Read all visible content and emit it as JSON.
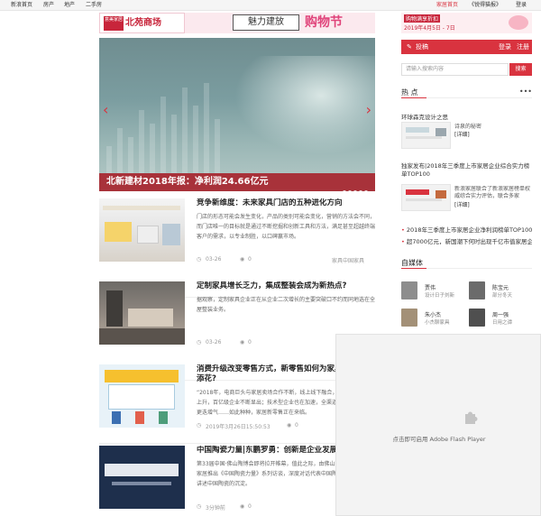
{
  "topbar": {
    "nav": [
      "新浪首页",
      "房产",
      "地产",
      "二手房"
    ],
    "right": {
      "home": "家居首页",
      "group": "《锐得猫报》",
      "login": "登录"
    }
  },
  "ad_banner": {
    "brand_small": "意美家居",
    "shop": "北苑商场",
    "slogan": "魅力建放",
    "event": "购物节",
    "side_tag": "购物满享折扣",
    "side_date": "2019年4月5日 - 7日"
  },
  "slider": {
    "caption": "北新建材2018年报：净利润24.66亿元",
    "dots": 5
  },
  "articles": [
    {
      "title": "竞争新维度：未来家具门店的五种进化方向",
      "desc": "门店的形态可能会发生变化，产品的类别可能会变化，营销的方法会不同，而门店唯一的目标就是通过不断挖掘和创新工具和方法，满足甚至超越终端客户的需求，以专业制胜，以口碑赢市场。",
      "date": "03-26",
      "views": "0",
      "source": "家具中国家具"
    },
    {
      "title": "定制家具增长乏力，集成整装会成为新热点?",
      "desc": "据观察，定制家具企业正在从企业二次增长的主要突破口不约而同地选在全屋整装业务。",
      "date": "03-26",
      "views": "0",
      "source": ""
    },
    {
      "title": "消费升级改变零售方式，新零售如何为家具行业锦上添花?",
      "desc": "“2018年，电商巨头与家居卖场合作不断，线上线下融合，家居企业成本上升，百亿级企业不断显出；技术型企业也在加速，全渠道运营能力与技术更迭增气……如此种种，家居新零售正在来临。",
      "date": "2019年3月26日15:50:53",
      "views": "0",
      "source": ""
    },
    {
      "title": "中国陶瓷力量|东鹏罗勇：创新是企业发展的核心动力",
      "desc": "第33届中国·佛山陶博会即将拉开帷幕，值此之际，由佛山陶博会联合新浪家居推出《中国陶瓷力量》系列访谈，深度对话代表中国陶瓷力量的企业，讲述中国陶瓷的沉淀。",
      "date": "3分钟前",
      "views": "0",
      "source": ""
    }
  ],
  "sidebar": {
    "post": "投稿",
    "login": "登录",
    "register": "注册",
    "search_placeholder": "请输入搜索内容",
    "search_btn": "搜索",
    "hot_title": "热 点",
    "more": "•••",
    "hot1": "环球森克设计之思",
    "hot1_sub": "诗泉的秘密",
    "hot1_tag": "[详细]",
    "hot2": "独家发布|2018年三季度上市家居企业综合实力榜单TOP100",
    "hot2_sub": "新浪家居联合了新浪家居榜单权威综合实力评估，联合多家",
    "hot2_tag": "[详细]",
    "hot_list": [
      "2018年三季度上市家居企业净利润榜单TOP100",
      "超7000亿元，新国潮下何时出现千亿市值家居企业"
    ],
    "media_title": "自媒体",
    "media": [
      {
        "name": "贾伟",
        "sub": "设计日子刘新"
      },
      {
        "name": "陈宝元",
        "sub": "部分冬天"
      },
      {
        "name": "朱小杰",
        "sub": "小杰聊家具"
      },
      {
        "name": "周一强",
        "sub": "日用之谭"
      }
    ]
  },
  "flash": {
    "text": "点击即可启用 Adobe Flash Player"
  }
}
